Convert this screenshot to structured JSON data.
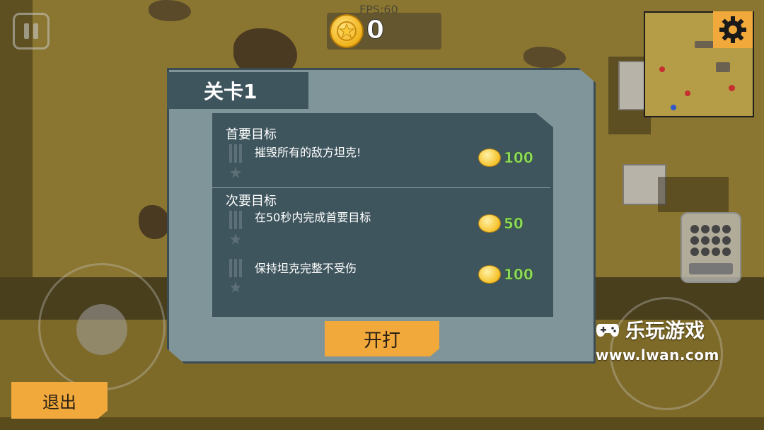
{
  "hud": {
    "fps_text": "FPS:60",
    "coin_count": "0",
    "pause_icon": "pause-icon",
    "settings_icon": "gear-icon"
  },
  "dialog": {
    "level_title": "关卡1",
    "primary": {
      "title": "首要目标",
      "objectives": [
        {
          "text": "摧毁所有的敌方坦克!",
          "reward": "100"
        }
      ]
    },
    "secondary": {
      "title": "次要目标",
      "objectives": [
        {
          "text": "在50秒内完成首要目标",
          "reward": "50"
        },
        {
          "text": "保持坦克完整不受伤",
          "reward": "100"
        }
      ]
    },
    "start_label": "开打"
  },
  "exit_label": "退出",
  "watermark": {
    "brand": "乐玩游戏",
    "url": "www.lwan.com"
  },
  "colors": {
    "accent_orange": "#f2a93b",
    "dialog_bg": "#7f959a",
    "panel_bg": "#3f555d",
    "reward_green": "#8edc5b"
  }
}
